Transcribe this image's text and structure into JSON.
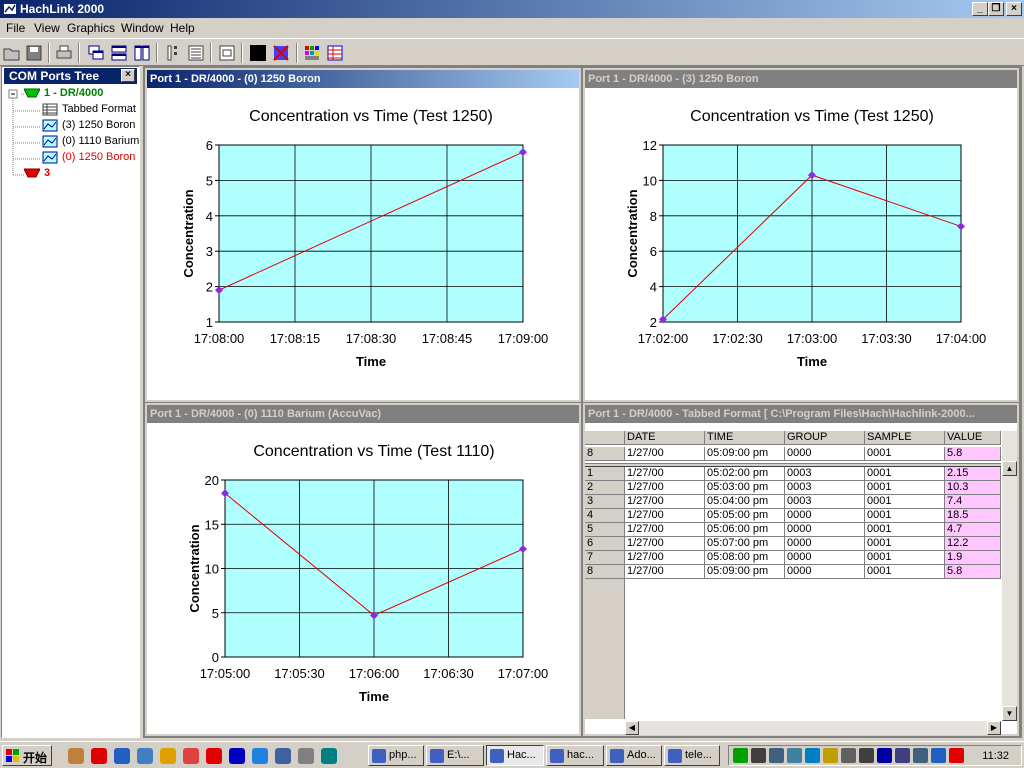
{
  "window": {
    "title": "HachLink 2000"
  },
  "menu": [
    "File",
    "View",
    "Graphics",
    "Window",
    "Help"
  ],
  "toolbar_icons": [
    "open-icon",
    "save-icon",
    "print-icon",
    "cascade-icon",
    "tile-horizontal-icon",
    "tile-vertical-icon",
    "list-icon",
    "details-icon",
    "window-icon",
    "black-fill-icon",
    "delete-icon",
    "grid-color-icon",
    "table-color-icon"
  ],
  "tree": {
    "title": "COM Ports Tree",
    "items": [
      {
        "label": "1 - DR/4000",
        "icon": "port-icon",
        "level": 0,
        "color": "#008000",
        "bold": true
      },
      {
        "label": "Tabbed Format",
        "icon": "table-icon",
        "level": 1
      },
      {
        "label": "(3) 1250  Boron",
        "icon": "graph-icon",
        "level": 1
      },
      {
        "label": "(0) 1110  Barium",
        "icon": "graph-icon",
        "level": 1
      },
      {
        "label": "(0) 1250  Boron",
        "icon": "graph-icon",
        "level": 1,
        "color": "#e00000"
      },
      {
        "label": "3",
        "icon": "port-icon",
        "level": 0,
        "color": "#e00000",
        "bold": true
      }
    ]
  },
  "windows": {
    "w1": {
      "title": "Port 1 - DR/4000 - (0) 1250  Boron"
    },
    "w2": {
      "title": "Port 1 - DR/4000 - (3) 1250  Boron"
    },
    "w3": {
      "title": "Port 1 - DR/4000 - (0) 1110  Barium (AccuVac)"
    },
    "w4": {
      "title": "Port 1 - DR/4000 - Tabbed Format [ C:\\Program Files\\Hach\\Hachlink-2000..."
    }
  },
  "chart_data": [
    {
      "type": "line",
      "title": "Concentration vs Time (Test 1250)",
      "xlabel": "Time",
      "ylabel": "Concentration",
      "xticks": [
        "17:08:00",
        "17:08:15",
        "17:08:30",
        "17:08:45",
        "17:09:00"
      ],
      "yticks": [
        "1",
        "2",
        "3",
        "4",
        "5",
        "6"
      ],
      "xlim": [
        0,
        60
      ],
      "ylim": [
        1,
        6
      ],
      "x": [
        0,
        60
      ],
      "y": [
        1.9,
        5.8
      ],
      "line_color": "#e00000",
      "marker_color": "#8a2be2",
      "plot_bg": "#b0ffff",
      "grid": true
    },
    {
      "type": "line",
      "title": "Concentration vs Time (Test 1250)",
      "xlabel": "Time",
      "ylabel": "Concentration",
      "xticks": [
        "17:02:00",
        "17:02:30",
        "17:03:00",
        "17:03:30",
        "17:04:00"
      ],
      "yticks": [
        "2",
        "4",
        "6",
        "8",
        "10",
        "12"
      ],
      "xlim": [
        0,
        120
      ],
      "ylim": [
        2,
        12
      ],
      "x": [
        0,
        60,
        120
      ],
      "y": [
        2.15,
        10.3,
        7.4
      ],
      "line_color": "#e00000",
      "marker_color": "#8a2be2",
      "plot_bg": "#b0ffff",
      "grid": true
    },
    {
      "type": "line",
      "title": "Concentration vs Time (Test 1110)",
      "xlabel": "Time",
      "ylabel": "Concentration",
      "xticks": [
        "17:05:00",
        "17:05:30",
        "17:06:00",
        "17:06:30",
        "17:07:00"
      ],
      "yticks": [
        "0",
        "5",
        "10",
        "15",
        "20"
      ],
      "xlim": [
        0,
        120
      ],
      "ylim": [
        0,
        20
      ],
      "x": [
        0,
        60,
        120
      ],
      "y": [
        18.5,
        4.7,
        12.2
      ],
      "line_color": "#e00000",
      "marker_color": "#8a2be2",
      "plot_bg": "#b0ffff",
      "grid": true
    }
  ],
  "table": {
    "columns": [
      "DATE",
      "TIME",
      "GROUP",
      "SAMPLE",
      "VALUE"
    ],
    "pinned": {
      "num": "8",
      "cells": [
        "1/27/00",
        "05:09:00 pm",
        "0000",
        "0001",
        "5.8"
      ]
    },
    "rows": [
      {
        "num": "1",
        "cells": [
          "1/27/00",
          "05:02:00 pm",
          "0003",
          "0001",
          "2.15"
        ]
      },
      {
        "num": "2",
        "cells": [
          "1/27/00",
          "05:03:00 pm",
          "0003",
          "0001",
          "10.3"
        ]
      },
      {
        "num": "3",
        "cells": [
          "1/27/00",
          "05:04:00 pm",
          "0003",
          "0001",
          "7.4"
        ]
      },
      {
        "num": "4",
        "cells": [
          "1/27/00",
          "05:05:00 pm",
          "0000",
          "0001",
          "18.5"
        ]
      },
      {
        "num": "5",
        "cells": [
          "1/27/00",
          "05:06:00 pm",
          "0000",
          "0001",
          "4.7"
        ]
      },
      {
        "num": "6",
        "cells": [
          "1/27/00",
          "05:07:00 pm",
          "0000",
          "0001",
          "12.2"
        ]
      },
      {
        "num": "7",
        "cells": [
          "1/27/00",
          "05:08:00 pm",
          "0000",
          "0001",
          "1.9"
        ]
      },
      {
        "num": "8",
        "cells": [
          "1/27/00",
          "05:09:00 pm",
          "0000",
          "0001",
          "5.8"
        ]
      }
    ]
  },
  "taskbar": {
    "start_label": "开始",
    "tasks": [
      {
        "label": "php...",
        "icon": "php-icon"
      },
      {
        "label": "E:\\...",
        "icon": "folder-icon"
      },
      {
        "label": "Hac...",
        "icon": "hachlink-icon",
        "pressed": true
      },
      {
        "label": "hac...",
        "icon": "hachlink-icon"
      },
      {
        "label": "Ado...",
        "icon": "adobe-icon"
      },
      {
        "label": "tele...",
        "icon": "telnet-icon"
      }
    ],
    "clock": "11:32"
  }
}
